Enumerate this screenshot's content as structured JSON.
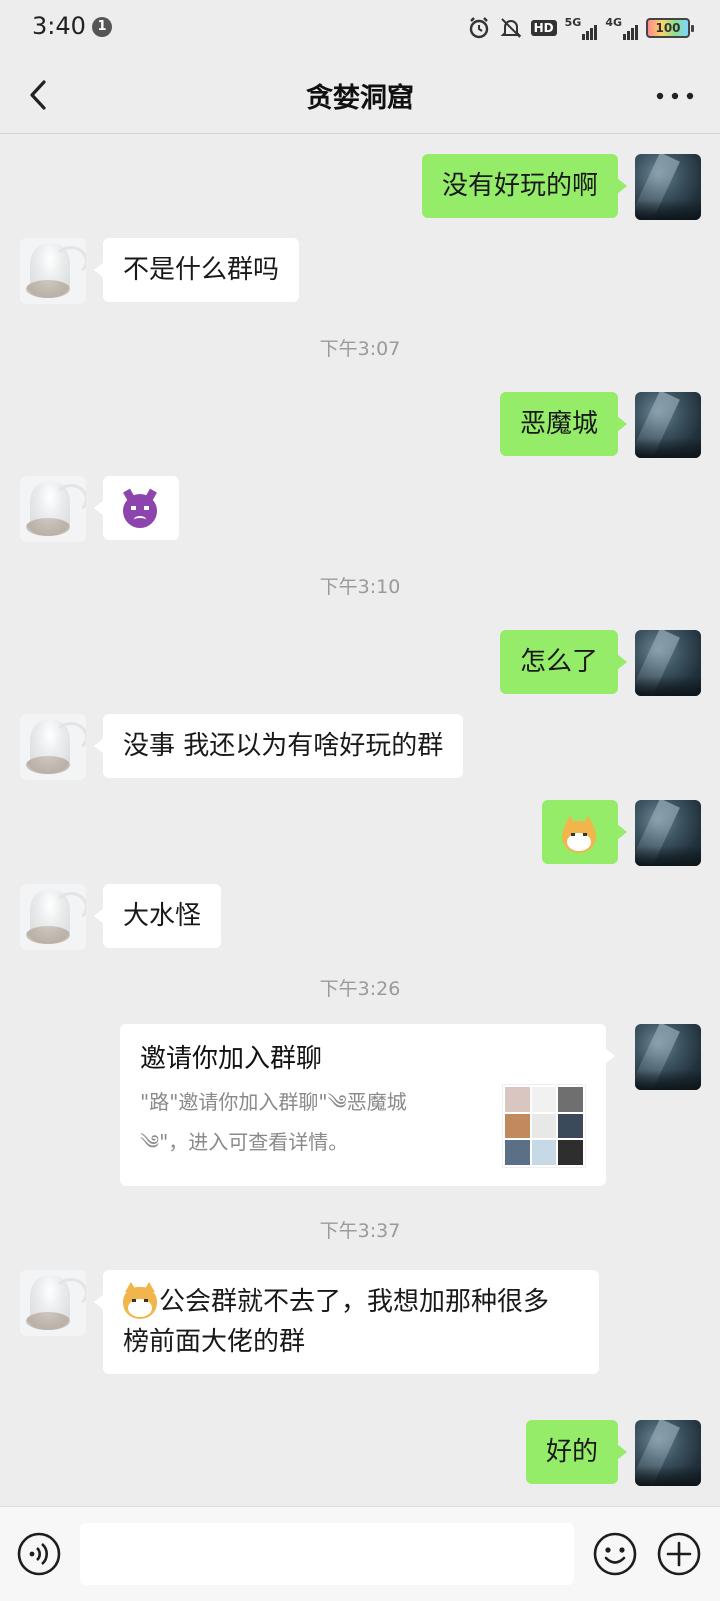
{
  "status_bar": {
    "time": "3:40",
    "notification_count": "1",
    "hd_label": "HD",
    "net1": "5G",
    "net2": "4G",
    "battery": "100"
  },
  "header": {
    "title": "贪婪洞窟"
  },
  "messages": [
    {
      "sender": "me",
      "text": "没有好玩的啊"
    },
    {
      "sender": "them",
      "text": "不是什么群吗"
    },
    {
      "type": "time",
      "text": "下午3:07"
    },
    {
      "sender": "me",
      "text": "恶魔城"
    },
    {
      "sender": "them",
      "emoji": "smiling-devil-emoji"
    },
    {
      "type": "time",
      "text": "下午3:10"
    },
    {
      "sender": "me",
      "text": "怎么了"
    },
    {
      "sender": "them",
      "text": "没事 我还以为有啥好玩的群"
    },
    {
      "sender": "me",
      "emoji": "doge-emoji"
    },
    {
      "sender": "them",
      "text": "大水怪"
    },
    {
      "type": "time",
      "text": "下午3:26"
    },
    {
      "sender": "me",
      "type": "invite_card",
      "title": "邀请你加入群聊",
      "desc": "\"路\"邀请你加入群聊\"༄恶魔城༄\"，进入可查看详情。"
    },
    {
      "type": "time",
      "text": "下午3:37"
    },
    {
      "sender": "them",
      "text": "公会群就不去了，我想加那种很多榜前面大佬的群",
      "line1": "公会群就不去了，我想加那种很多",
      "line2": "榜前面大佬的群"
    },
    {
      "sender": "me",
      "text": "好的"
    }
  ],
  "input_bar": {
    "placeholder": ""
  },
  "colors": {
    "background": "#ededed",
    "my_bubble": "#95ec69",
    "their_bubble": "#ffffff",
    "timestamp": "#9a9a9a"
  }
}
